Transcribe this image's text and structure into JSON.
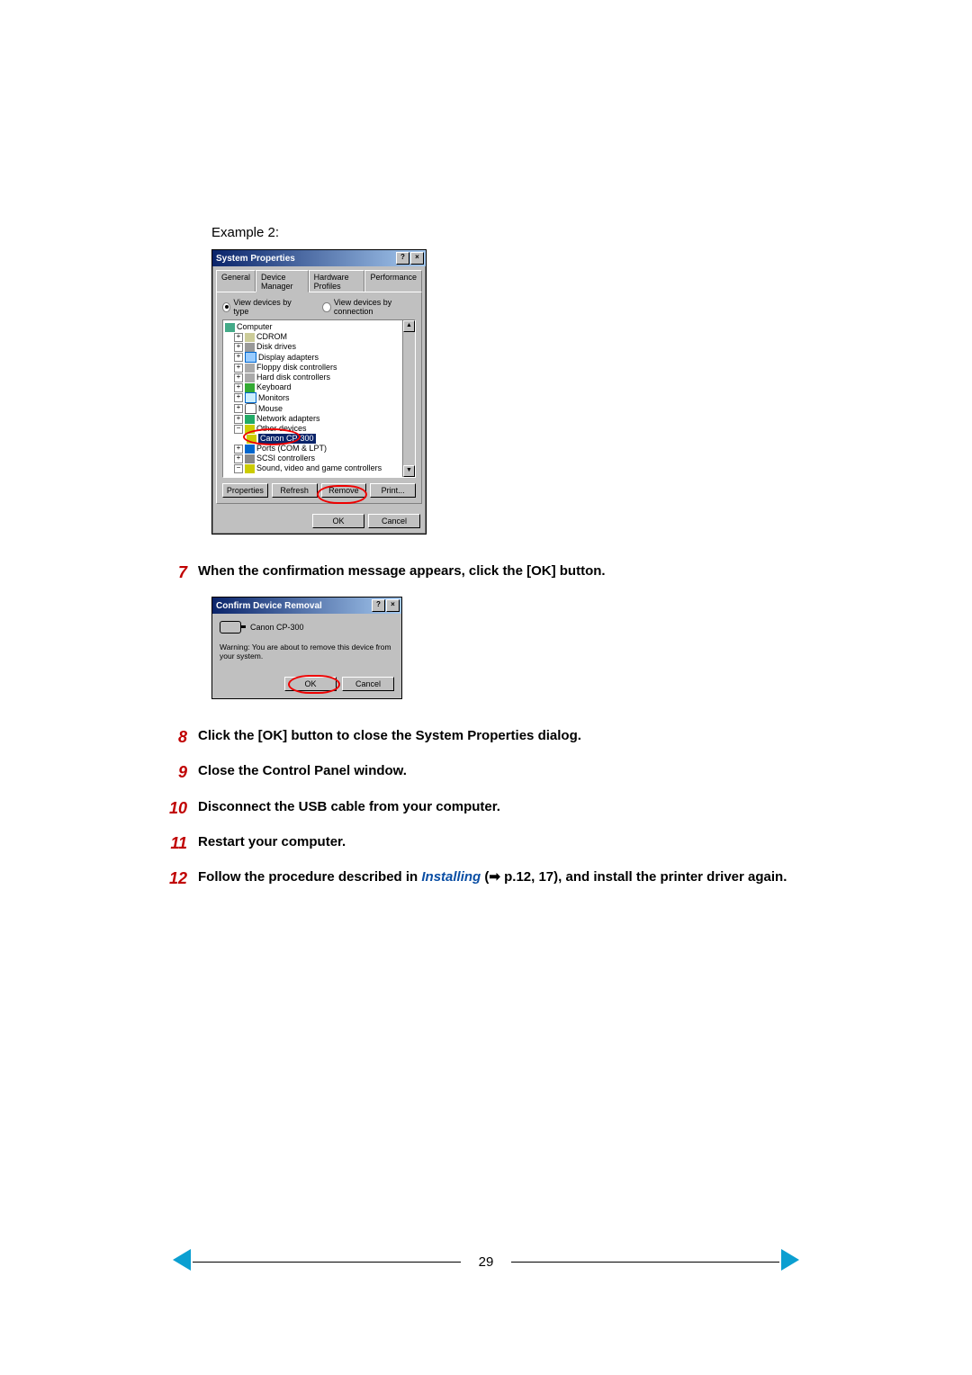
{
  "example_label": "Example 2:",
  "sysprops": {
    "title": "System Properties",
    "tabs": [
      "General",
      "Device Manager",
      "Hardware Profiles",
      "Performance"
    ],
    "radio_type": "View devices by type",
    "radio_conn": "View devices by connection",
    "tree": [
      "Computer",
      "CDROM",
      "Disk drives",
      "Display adapters",
      "Floppy disk controllers",
      "Hard disk controllers",
      "Keyboard",
      "Monitors",
      "Mouse",
      "Network adapters",
      "Other devices",
      "Canon CP-300",
      "Ports (COM & LPT)",
      "SCSI controllers",
      "Sound, video and game controllers"
    ],
    "btn_props": "Properties",
    "btn_refresh": "Refresh",
    "btn_remove": "Remove",
    "btn_print": "Print...",
    "btn_ok": "OK",
    "btn_cancel": "Cancel"
  },
  "steps": {
    "7": "When the confirmation message appears, click the [OK] button.",
    "8": "Click the [OK] button to close the System Properties dialog.",
    "9": "Close the Control Panel window.",
    "10": "Disconnect the USB cable from your computer.",
    "11": "Restart your computer.",
    "12a": "Follow the procedure described in ",
    "12link": "Installing",
    "12b": " (➡ p.12,  17), and install the printer driver again."
  },
  "confirm": {
    "title": "Confirm Device Removal",
    "device": "Canon CP-300",
    "warning": "Warning: You are about to remove this device from your system.",
    "ok": "OK",
    "cancel": "Cancel"
  },
  "page_number": "29"
}
